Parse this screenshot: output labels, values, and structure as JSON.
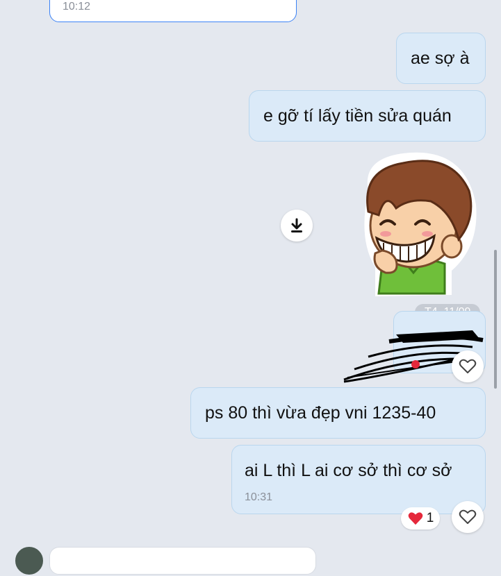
{
  "messages": {
    "m0": {
      "time": "10:12"
    },
    "m1": {
      "text": "ae sợ à"
    },
    "m2": {
      "text": "e gỡ tí lấy tiền sửa quán"
    },
    "m3": {
      "sticker": "grinning-boy-sticker",
      "download_icon": "download-icon"
    },
    "date_divider": "T4, 11/09",
    "m4": {
      "redacted": true,
      "react_icon": "heart-outline-icon"
    },
    "m5": {
      "text": "ps 80 thì vừa đẹp vni 1235-40"
    },
    "m6": {
      "text": "ai L thì L ai cơ sở thì cơ sở",
      "time": "10:31"
    },
    "reaction": {
      "emoji_icon": "red-heart-icon",
      "count": "1"
    },
    "react_button": {
      "icon": "heart-outline-icon"
    }
  },
  "colors": {
    "background": "#e4e8ef",
    "bubble_outgoing": "#dbeaf8",
    "bubble_border": "#b9d6ee",
    "accent": "#3b82f6",
    "heart": "#e5283b"
  }
}
